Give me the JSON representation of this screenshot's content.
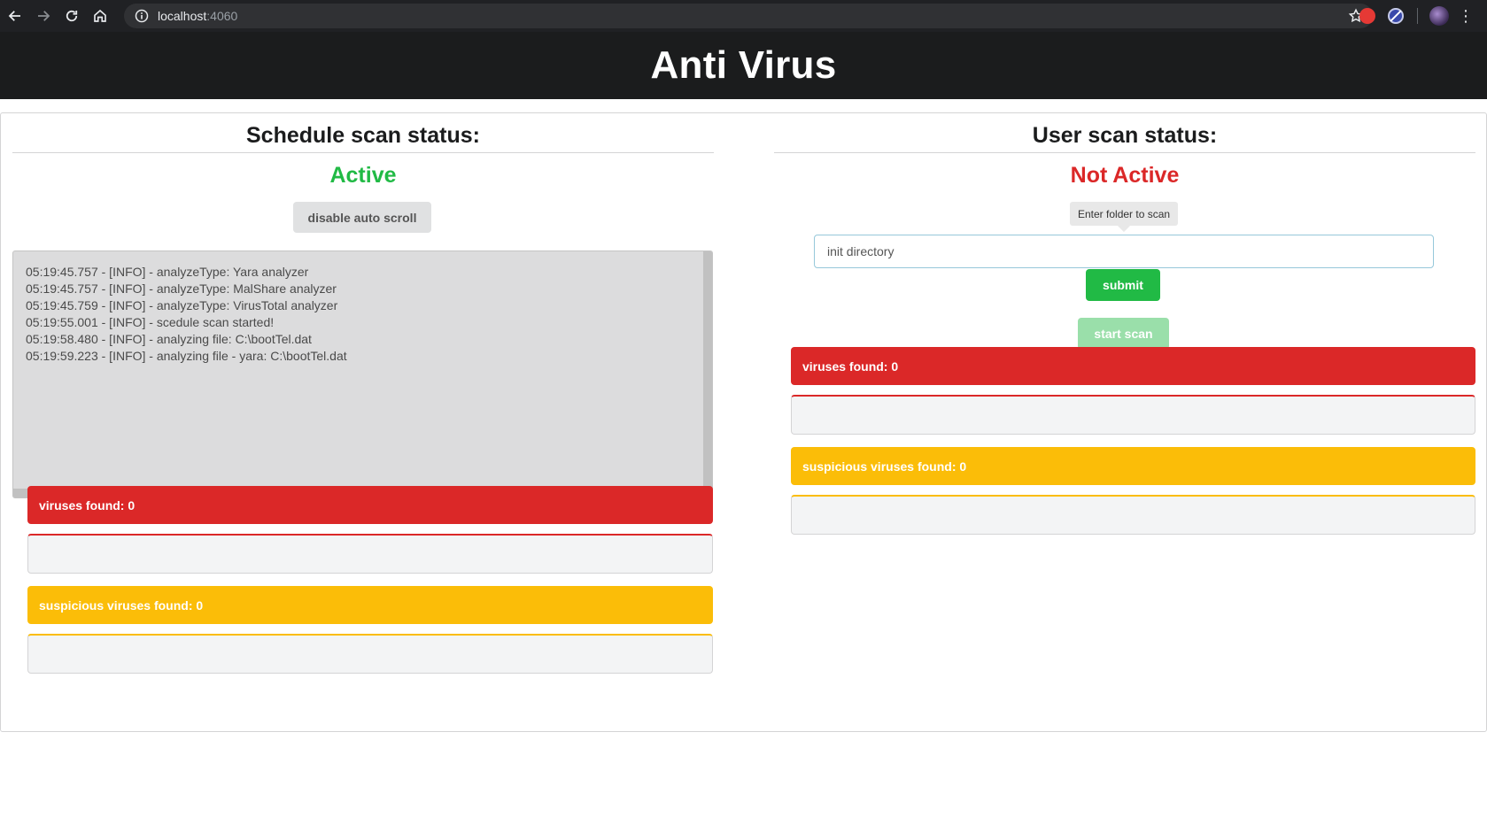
{
  "browser": {
    "url_host": "localhost",
    "url_port": ":4060"
  },
  "app": {
    "title": "Anti Virus"
  },
  "schedule": {
    "heading": "Schedule scan status:",
    "status": "Active",
    "autoscroll_button": "disable auto scroll",
    "log_lines": [
      "05:19:45.757 - [INFO] - analyzeType: Yara analyzer",
      "05:19:45.757 - [INFO] - analyzeType: MalShare analyzer",
      "05:19:45.759 - [INFO] - analyzeType: VirusTotal analyzer",
      "05:19:55.001 - [INFO] - scedule scan started!",
      "05:19:58.480 - [INFO] - analyzing file: C:\\bootTel.dat",
      "05:19:59.223 - [INFO] - analyzing file - yara: C:\\bootTel.dat"
    ],
    "viruses_found": "viruses found: 0",
    "suspicious_found": "suspicious viruses found: 0"
  },
  "user": {
    "heading": "User scan status:",
    "status": "Not Active",
    "tooltip": "Enter folder to scan",
    "input_placeholder": "init directory",
    "submit_button": "submit",
    "start_button": "start scan",
    "viruses_found": "viruses found: 0",
    "suspicious_found": "suspicious viruses found: 0"
  },
  "colors": {
    "active": "#21ba45",
    "inactive": "#db2828",
    "danger": "#db2828",
    "warning": "#fbbd08",
    "header_bg": "#1b1c1d"
  }
}
